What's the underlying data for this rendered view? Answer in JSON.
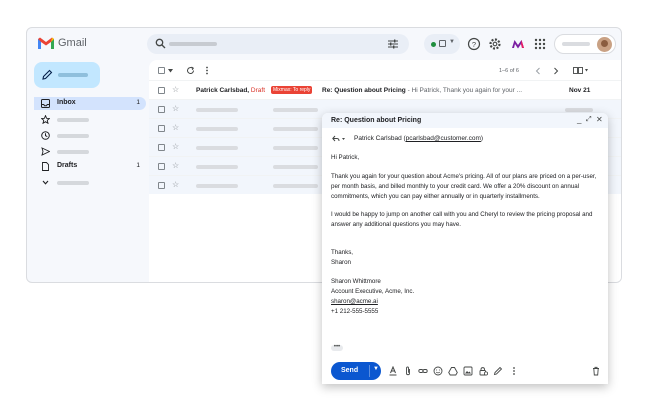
{
  "app": {
    "brand": "Gmail",
    "accent_color": "#0b57d0",
    "compose_color": "#c2e7ff"
  },
  "sidebar": {
    "items": [
      {
        "label": "Inbox",
        "count": "1",
        "icon": "inbox-icon"
      },
      {
        "label": "",
        "icon": "star-icon"
      },
      {
        "label": "",
        "icon": "clock-icon"
      },
      {
        "label": "",
        "icon": "send-icon"
      },
      {
        "label": "Drafts",
        "count": "1",
        "icon": "file-icon"
      },
      {
        "label": "",
        "icon": "chevron-down-icon"
      }
    ]
  },
  "toolbar": {
    "pagination": "1–6 of 6"
  },
  "email_list": {
    "first": {
      "sender": "Patrick Carlsbad,",
      "draft_label": "Draft",
      "tag": "Mixmax: To reply",
      "subject": "Re:  Question about Pricing",
      "snippet": " - Hi Patrick, Thank you again for your ...",
      "date": "Nov 21"
    }
  },
  "compose": {
    "title": "Re:  Question about Pricing",
    "recipient_name": "Patrick Carlsbad",
    "recipient_email": "pcarlsbad@customer.com",
    "greeting": "Hi Patrick,",
    "para1": "Thank you again for your question about Acme's pricing. All of our plans are priced on a per-user, per month basis, and billed monthly to your credit card. We offer a 20% discount on annual commitments, which you can pay either annually or in quarterly installments.",
    "para2": "I would be happy to jump on another call with you and Cheryl to review the pricing proposal and answer any additional questions you may have.",
    "closing": "Thanks,",
    "closing_name": "Sharon",
    "sig_name": "Sharon Whittmore",
    "sig_title": "Account Executive, Acme, Inc.",
    "sig_email": "sharon@acme.ai",
    "sig_phone": "+1 212-555-5555",
    "send_label": "Send"
  }
}
